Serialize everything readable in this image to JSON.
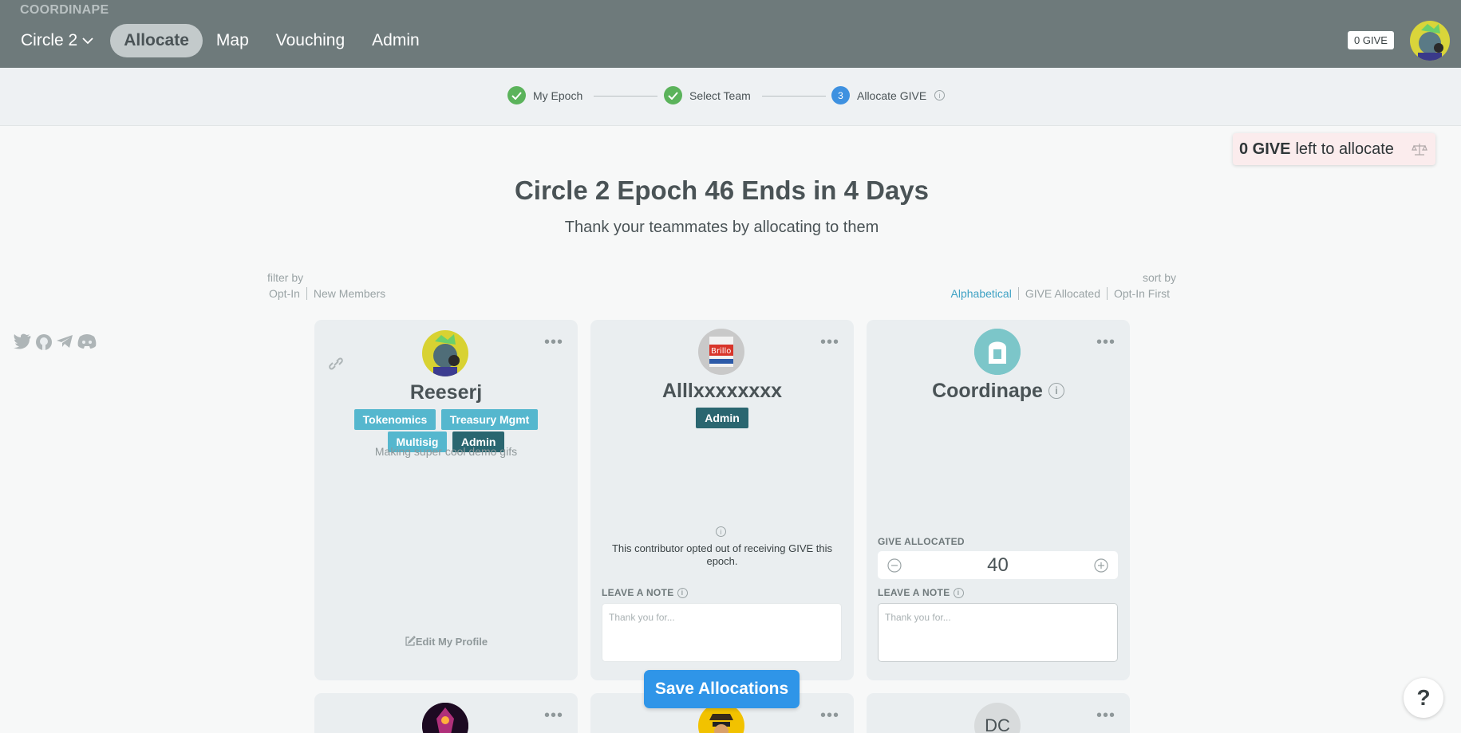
{
  "header": {
    "logo": "COORDINAPE",
    "circle_select": "Circle 2",
    "nav": [
      "Allocate",
      "Map",
      "Vouching",
      "Admin"
    ],
    "give_badge": "0 GIVE"
  },
  "stepper": {
    "steps": [
      {
        "label": "My Epoch",
        "state": "done"
      },
      {
        "label": "Select Team",
        "state": "done"
      },
      {
        "label": "Allocate GIVE",
        "state": "current",
        "number": "3"
      }
    ]
  },
  "allocation_status": {
    "amount": "0 GIVE",
    "suffix": "left to allocate"
  },
  "page": {
    "title": "Circle 2 Epoch 46 Ends in 4 Days",
    "subtitle": "Thank your teammates by allocating to them"
  },
  "filter": {
    "label": "filter by",
    "options": [
      "Opt-In",
      "New Members"
    ]
  },
  "sort": {
    "label": "sort by",
    "options": [
      "Alphabetical",
      "GIVE Allocated",
      "Opt-In First"
    ],
    "selected": "Alphabetical"
  },
  "cards": [
    {
      "name": "Reeserj",
      "tags": [
        "Tokenomics",
        "Treasury Mgmt",
        "Multisig"
      ],
      "role": "Admin",
      "bio": "Making super cool demo gifs",
      "edit_label": "Edit My Profile"
    },
    {
      "name": "Alllxxxxxxxx",
      "role": "Admin",
      "opted_out_text": "This contributor opted out of receiving GIVE this epoch.",
      "note_label": "LEAVE A NOTE",
      "note_placeholder": "Thank you for..."
    },
    {
      "name": "Coordinape",
      "give_label": "GIVE ALLOCATED",
      "give_value": "40",
      "note_label": "LEAVE A NOTE",
      "note_placeholder": "Thank you for..."
    }
  ],
  "bottom_cards": [
    {
      "initials": ""
    },
    {
      "initials": ""
    },
    {
      "initials": "DC"
    }
  ],
  "save_button": "Save Allocations",
  "help_button": "?",
  "colors": {
    "header_bg": "#6e7a7b",
    "accent": "#2f95e8",
    "tag": "#55b7ce",
    "admin_tag": "#2a6670",
    "done": "#5bb35b"
  }
}
